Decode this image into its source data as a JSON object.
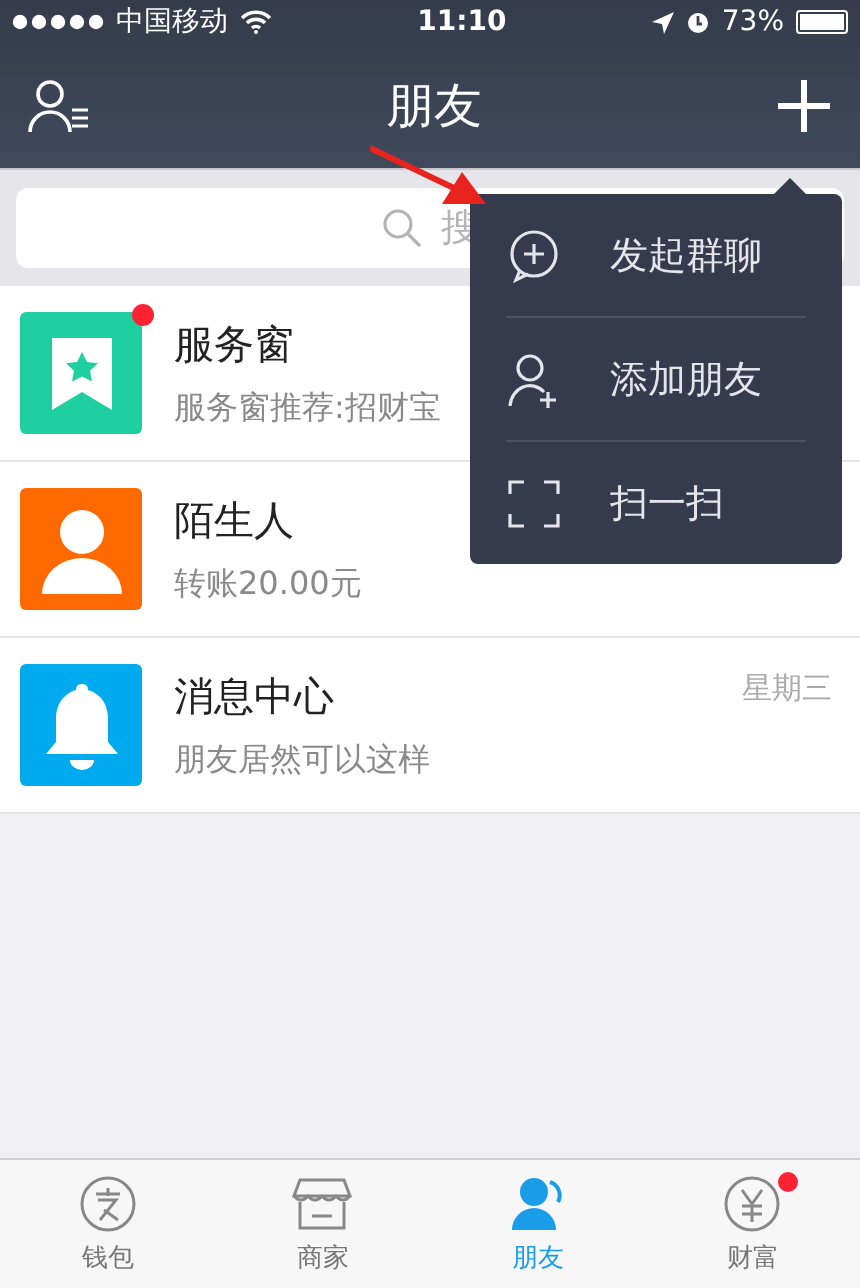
{
  "status_bar": {
    "carrier": "中国移动",
    "time": "11:10",
    "battery": "73%"
  },
  "nav_bar": {
    "title": "朋友"
  },
  "search": {
    "placeholder": "搜"
  },
  "conversations": [
    {
      "kind": "service",
      "name": "服务窗",
      "preview": "服务窗推荐:招财宝",
      "unread": true,
      "color": "#1ecf9f"
    },
    {
      "kind": "stranger",
      "name": "陌生人",
      "preview": "转账20.00元",
      "unread": false,
      "color": "#ff6a00"
    },
    {
      "kind": "notice",
      "name": "消息中心",
      "preview": "朋友居然可以这样",
      "time": "星期三",
      "unread": false,
      "color": "#00aaee"
    }
  ],
  "popup_menu": [
    {
      "kind": "group-chat",
      "label": "发起群聊"
    },
    {
      "kind": "add-friend",
      "label": "添加朋友"
    },
    {
      "kind": "scan",
      "label": "扫一扫"
    }
  ],
  "tab_bar": [
    {
      "kind": "wallet",
      "label": "钱包",
      "selected": false,
      "badge": false
    },
    {
      "kind": "shop",
      "label": "商家",
      "selected": false,
      "badge": false
    },
    {
      "kind": "friends",
      "label": "朋友",
      "selected": true,
      "badge": false
    },
    {
      "kind": "wealth",
      "label": "财富",
      "selected": false,
      "badge": true
    }
  ]
}
